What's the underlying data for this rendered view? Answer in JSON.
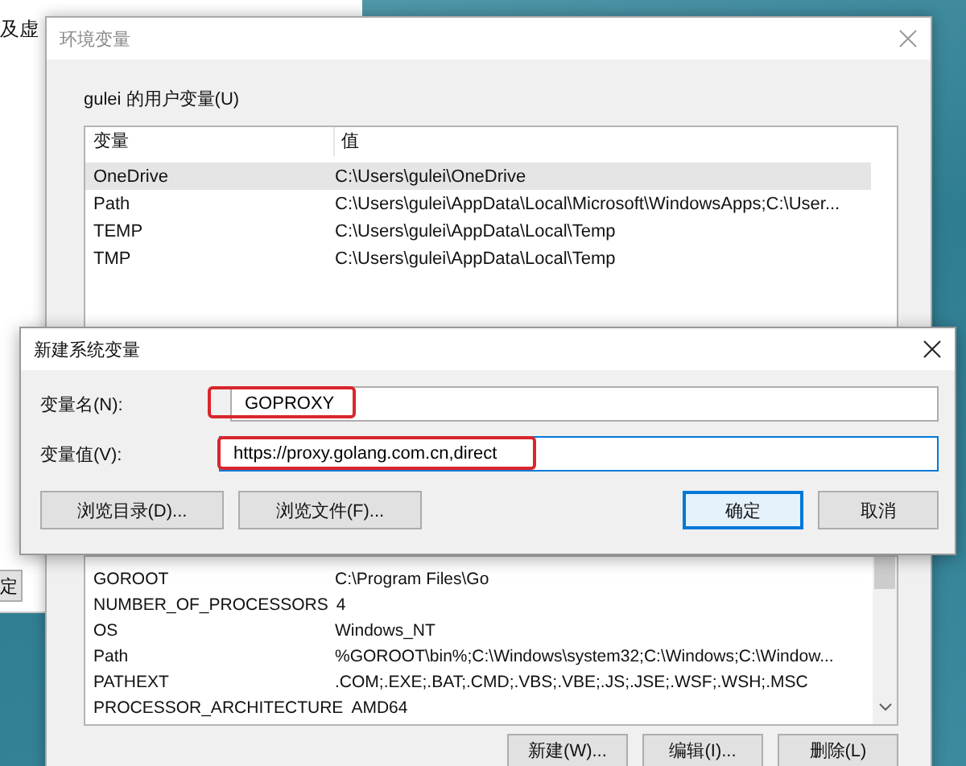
{
  "background_window": {
    "heading_fragment": "及虚",
    "button_fragment": "定"
  },
  "env_dialog": {
    "title": "环境变量",
    "user_variables": {
      "label": "gulei 的用户变量(U)",
      "columns": [
        "变量",
        "值"
      ],
      "rows": [
        {
          "name": "OneDrive",
          "value": "C:\\Users\\gulei\\OneDrive",
          "selected": true
        },
        {
          "name": "Path",
          "value": "C:\\Users\\gulei\\AppData\\Local\\Microsoft\\WindowsApps;C:\\User...",
          "selected": false
        },
        {
          "name": "TEMP",
          "value": "C:\\Users\\gulei\\AppData\\Local\\Temp",
          "selected": false
        },
        {
          "name": "TMP",
          "value": "C:\\Users\\gulei\\AppData\\Local\\Temp",
          "selected": false
        }
      ]
    },
    "system_variables": {
      "rows": [
        {
          "name": "GOROOT",
          "value": "C:\\Program Files\\Go",
          "selected": false
        },
        {
          "name": "NUMBER_OF_PROCESSORS",
          "value": "4",
          "selected": false
        },
        {
          "name": "OS",
          "value": "Windows_NT",
          "selected": false
        },
        {
          "name": "Path",
          "value": "%GOROOT\\bin%;C:\\Windows\\system32;C:\\Windows;C:\\Window...",
          "selected": false
        },
        {
          "name": "PATHEXT",
          "value": ".COM;.EXE;.BAT;.CMD;.VBS;.VBE;.JS;.JSE;.WSF;.WSH;.MSC",
          "selected": false
        },
        {
          "name": "PROCESSOR_ARCHITECTURE",
          "value": "AMD64",
          "selected": false
        }
      ]
    },
    "buttons": [
      "新建(W)...",
      "编辑(I)...",
      "删除(L)"
    ]
  },
  "new_variable_dialog": {
    "title": "新建系统变量",
    "fields": [
      {
        "label": "变量名(N):",
        "value": "GOPROXY",
        "focused": false,
        "annotated": true
      },
      {
        "label": "变量值(V):",
        "value": "https://proxy.golang.com.cn,direct",
        "focused": true,
        "annotated": true
      }
    ],
    "buttons": [
      {
        "label": "浏览目录(D)...",
        "default": false,
        "kind": "left"
      },
      {
        "label": "浏览文件(F)...",
        "default": false,
        "kind": "left"
      },
      {
        "label": "确定",
        "default": true,
        "kind": "right"
      },
      {
        "label": "取消",
        "default": false,
        "kind": "right"
      }
    ]
  }
}
